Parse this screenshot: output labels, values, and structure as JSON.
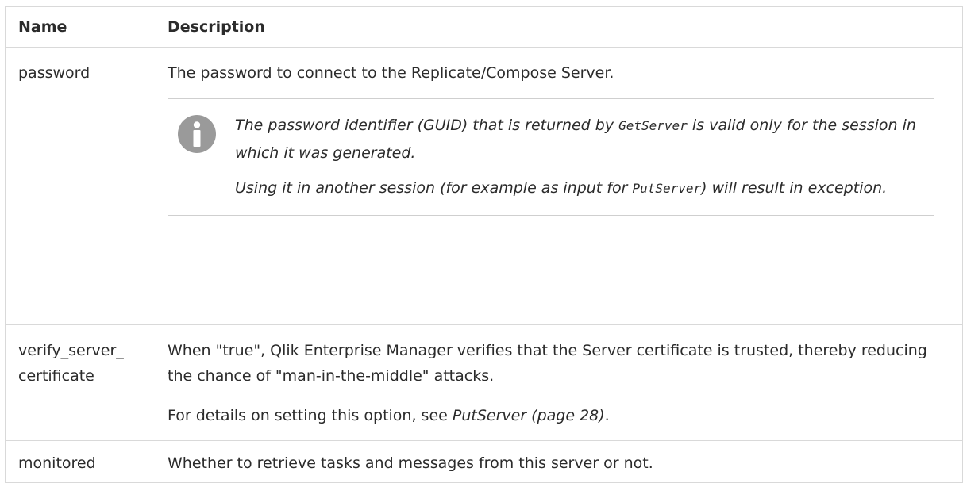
{
  "table": {
    "headers": {
      "name": "Name",
      "description": "Description"
    },
    "rows": {
      "password": {
        "name": "password",
        "description": "The password to connect to the Replicate/Compose Server.",
        "note": {
          "icon": "info-icon",
          "p1_before": "The password identifier (GUID) that is returned by ",
          "p1_code": "GetServer",
          "p1_after": " is valid only for the session in which it was generated.",
          "p2_before": "Using it in another session (for example as input for ",
          "p2_code": "PutServer",
          "p2_after": ") will result in exception."
        }
      },
      "verify": {
        "name_line1": "verify_server_",
        "name_line2": "certificate",
        "description": "When \"true\", Qlik Enterprise Manager verifies that the Server certificate is trusted, thereby reducing the chance of \"man-in-the-middle\" attacks.",
        "details_before": "For details on setting this option, see ",
        "details_link": "PutServer (page 28)",
        "details_after": "."
      },
      "monitored": {
        "name": "monitored",
        "description": "Whether to retrieve tasks and messages from this server or not."
      }
    }
  },
  "colors": {
    "border": "#d9d9d9",
    "note_border": "#cfcfcf",
    "icon": "#9a9a9a",
    "text": "#2b2b2b"
  }
}
